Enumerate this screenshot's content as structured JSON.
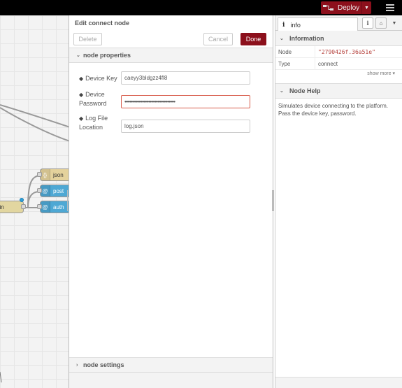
{
  "header": {
    "deploy_label": "Deploy"
  },
  "workspace": {
    "nodes": {
      "json": "json",
      "post": "post",
      "auth": "auth",
      "join": "oin"
    }
  },
  "tray": {
    "title": "Edit connect node",
    "delete_label": "Delete",
    "cancel_label": "Cancel",
    "done_label": "Done",
    "properties_section": "node properties",
    "settings_section": "node settings",
    "fields": {
      "device_key_label": "Device Key",
      "device_key_value": "caeyy3bldgzz4fl8",
      "device_password_label": "Device Password",
      "device_password_value": "••••••••••••••••••••••••••••••••••••••••",
      "log_file_label": "Log File Location",
      "log_file_value": "log.json"
    }
  },
  "sidebar": {
    "tab_label": "info",
    "information_section": "Information",
    "info_rows": [
      {
        "key": "Node",
        "value": "\"2790426f.36a51e\""
      },
      {
        "key": "Type",
        "value": "connect"
      }
    ],
    "show_more": "show more ▾",
    "help_section": "Node Help",
    "help_text": "Simulates device connecting to the platform. Pass the device key, password."
  },
  "colors": {
    "accent": "#8c101c",
    "header_bg": "#000000",
    "node_blue": "#4ea8d4",
    "node_tan": "#e4d29c"
  }
}
